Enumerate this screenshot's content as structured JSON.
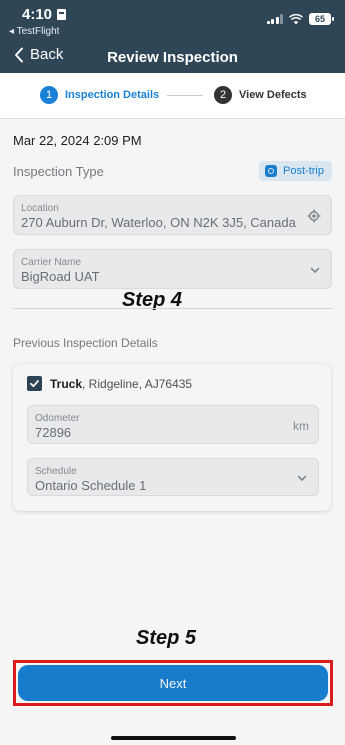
{
  "status_bar": {
    "time": "4:10",
    "back_app": "◂ TestFlight",
    "battery": "65"
  },
  "nav": {
    "back_label": "Back",
    "title": "Review Inspection"
  },
  "stepper": {
    "steps": [
      {
        "num": "1",
        "label": "Inspection Details"
      },
      {
        "num": "2",
        "label": "View Defects"
      }
    ]
  },
  "inspection": {
    "date": "Mar 22, 2024 2:09 PM",
    "type_label": "Inspection Type",
    "type_value": "Post-trip",
    "location_label": "Location",
    "location_value": "270 Auburn Dr, Waterloo, ON N2K 3J5, Canada",
    "carrier_label": "Carrier Name",
    "carrier_value": "BigRoad UAT"
  },
  "previous": {
    "section_label": "Previous Inspection Details",
    "vehicle_name": "Truck",
    "vehicle_details": ", Ridgeline, AJ76435",
    "odometer_label": "Odometer",
    "odometer_value": "72896",
    "odometer_unit": "km",
    "schedule_label": "Schedule",
    "schedule_value": "Ontario Schedule 1"
  },
  "annotations": {
    "step4": "Step 4",
    "step5": "Step 5"
  },
  "footer": {
    "next_label": "Next"
  },
  "colors": {
    "header": "#2f4657",
    "accent": "#1a82d6",
    "highlight": "#e0201e"
  }
}
